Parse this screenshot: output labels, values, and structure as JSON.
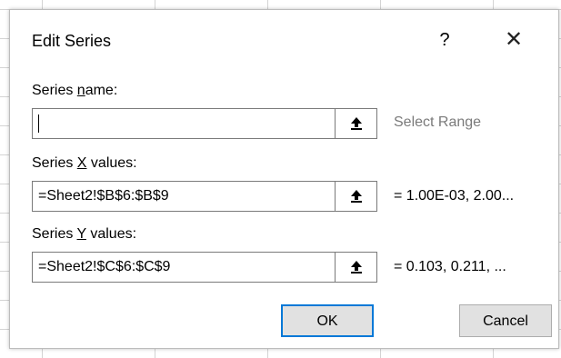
{
  "dialog": {
    "title": "Edit Series",
    "help_label": "?",
    "close_label": "✕"
  },
  "series_name": {
    "label_before": "Series ",
    "label_key": "n",
    "label_after": "ame:",
    "value": "",
    "preview": "Select Range"
  },
  "series_x": {
    "label_before": "Series ",
    "label_key": "X",
    "label_after": " values:",
    "value": "=Sheet2!$B$6:$B$9",
    "preview": "= 1.00E-03, 2.00..."
  },
  "series_y": {
    "label_before": "Series ",
    "label_key": "Y",
    "label_after": " values:",
    "value": "=Sheet2!$C$6:$C$9",
    "preview": "= 0.103, 0.211, ..."
  },
  "buttons": {
    "ok": "OK",
    "cancel": "Cancel"
  },
  "icons": {
    "range_selector": "collapse-dialog-up-arrow-icon"
  },
  "colors": {
    "ok_border": "#0078d7",
    "button_bg": "#e1e1e1",
    "muted_text": "#7a7a7a"
  }
}
